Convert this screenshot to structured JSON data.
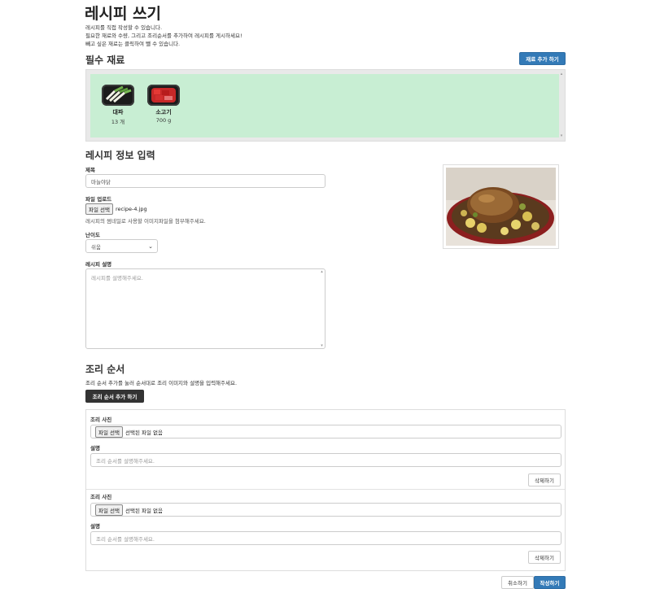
{
  "page": {
    "title": "레시피 쓰기",
    "intro_lines": [
      "레시피를 직접 작성할 수 있습니다.",
      "필요한 재료와 수량, 그리고 조리순서를 추가하여 레시피를 게시하세요!",
      "빼고 싶은 재료는 클릭하여 뺄 수 있습니다."
    ]
  },
  "ingredients": {
    "heading": "필수 재료",
    "add_button": "재료 추가 하기",
    "items": [
      {
        "name": "대파",
        "qty": "13 개",
        "icon": "green-onion-icon"
      },
      {
        "name": "소고기",
        "qty": "700 g",
        "icon": "beef-icon"
      }
    ]
  },
  "recipe_info": {
    "heading": "레시피 정보 입력",
    "title_label": "제목",
    "title_value": "마늘야닭",
    "upload_label": "파일 업로드",
    "upload_button": "파일 선택",
    "upload_file": "recipe-4.jpg",
    "upload_help": "레시피의 썸네일로 사용할 이미지파일을 첨부해주세요.",
    "difficulty_label": "난이도",
    "difficulty_value": "쉬움",
    "description_label": "레시피 설명",
    "description_placeholder": "레시피를 설명해주세요."
  },
  "steps": {
    "heading": "조리 순서",
    "help": "조리 순서 추가를 눌러 순서대로 조리 이미지와 설명을 입력해주세요.",
    "add_button": "조리 순서 추가 하기",
    "items": [
      {
        "photo_label": "조리 사진",
        "file_button": "파일 선택",
        "file_status": "선택된 파일 없음",
        "desc_label": "설명",
        "desc_placeholder": "조리 순서를 설명해주세요.",
        "delete_button": "삭제하기"
      },
      {
        "photo_label": "조리 사진",
        "file_button": "파일 선택",
        "file_status": "선택된 파일 없음",
        "desc_label": "설명",
        "desc_placeholder": "조리 순서를 설명해주세요.",
        "delete_button": "삭제하기"
      }
    ]
  },
  "footer": {
    "cancel_button": "취소하기",
    "submit_button": "작성하기"
  },
  "colors": {
    "primary": "#337ab7",
    "ingredient_bg": "#c8eed3",
    "dark_button": "#333333"
  }
}
